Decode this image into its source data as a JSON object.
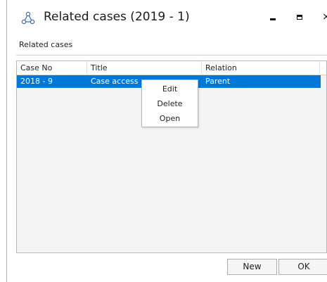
{
  "window": {
    "title": "Related cases (2019 - 1)",
    "app_icon": "share-nodes-icon",
    "minimize_icon": "minimize-icon",
    "maximize_icon": "maximize-icon",
    "close_icon": "close-icon",
    "close_glyph": "×"
  },
  "group": {
    "label": "Related cases"
  },
  "grid": {
    "columns": [
      "Case No",
      "Title",
      "Relation"
    ],
    "rows": [
      {
        "case_no": "2018 - 9",
        "title": "Case access",
        "relation": "Parent",
        "selected": true
      }
    ],
    "selection_color": "#0078d7"
  },
  "context_menu": {
    "items": [
      "Edit",
      "Delete",
      "Open"
    ]
  },
  "buttons": {
    "new": "New",
    "ok": "OK"
  }
}
